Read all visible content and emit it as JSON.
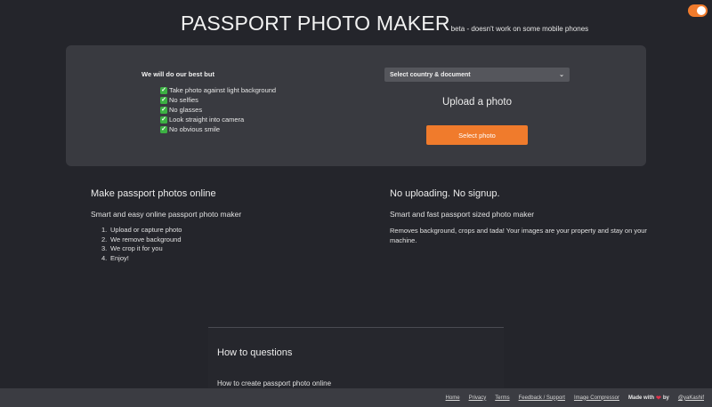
{
  "header": {
    "title": "PASSPORT PHOTO MAKER",
    "beta_note": "beta - doesn't work on some mobile phones"
  },
  "theme_toggle": {
    "state": "on",
    "color": "#f07b2c"
  },
  "panel": {
    "intro": "We will do our best but",
    "tips": [
      "Take photo against light background",
      "No selfies",
      "No glasses",
      "Look straight into camera",
      "No obvious smile"
    ],
    "check_icon": "checkmark-icon",
    "select_value": "Select country & document",
    "upload_heading": "Upload a photo",
    "select_button": "Select photo"
  },
  "left_section": {
    "title": "Make passport photos online",
    "subtitle": "Smart and easy online passport photo maker",
    "steps": [
      {
        "num": "1.",
        "text": "Upload or capture photo"
      },
      {
        "num": "2.",
        "text": "We remove background"
      },
      {
        "num": "3.",
        "text": "We crop it for you"
      },
      {
        "num": "4.",
        "text": "Enjoy!"
      }
    ]
  },
  "right_section": {
    "title": "No uploading. No signup.",
    "subtitle": "Smart and fast passport sized photo maker",
    "paragraph": "Removes background, crops and tada! Your images are your property and stay on your machine."
  },
  "howto": {
    "title": "How to questions",
    "first_question": "How to create passport photo online"
  },
  "footer": {
    "links": [
      "Home",
      "Privacy",
      "Terms",
      "Feedback / Support",
      "Image Compressor"
    ],
    "made_with": "Made with",
    "by": "by",
    "handle": "@yaKashif"
  },
  "colors": {
    "background": "#24252b",
    "panel": "#393a40",
    "accent": "#f07b2c",
    "footer": "#3b3c42"
  }
}
